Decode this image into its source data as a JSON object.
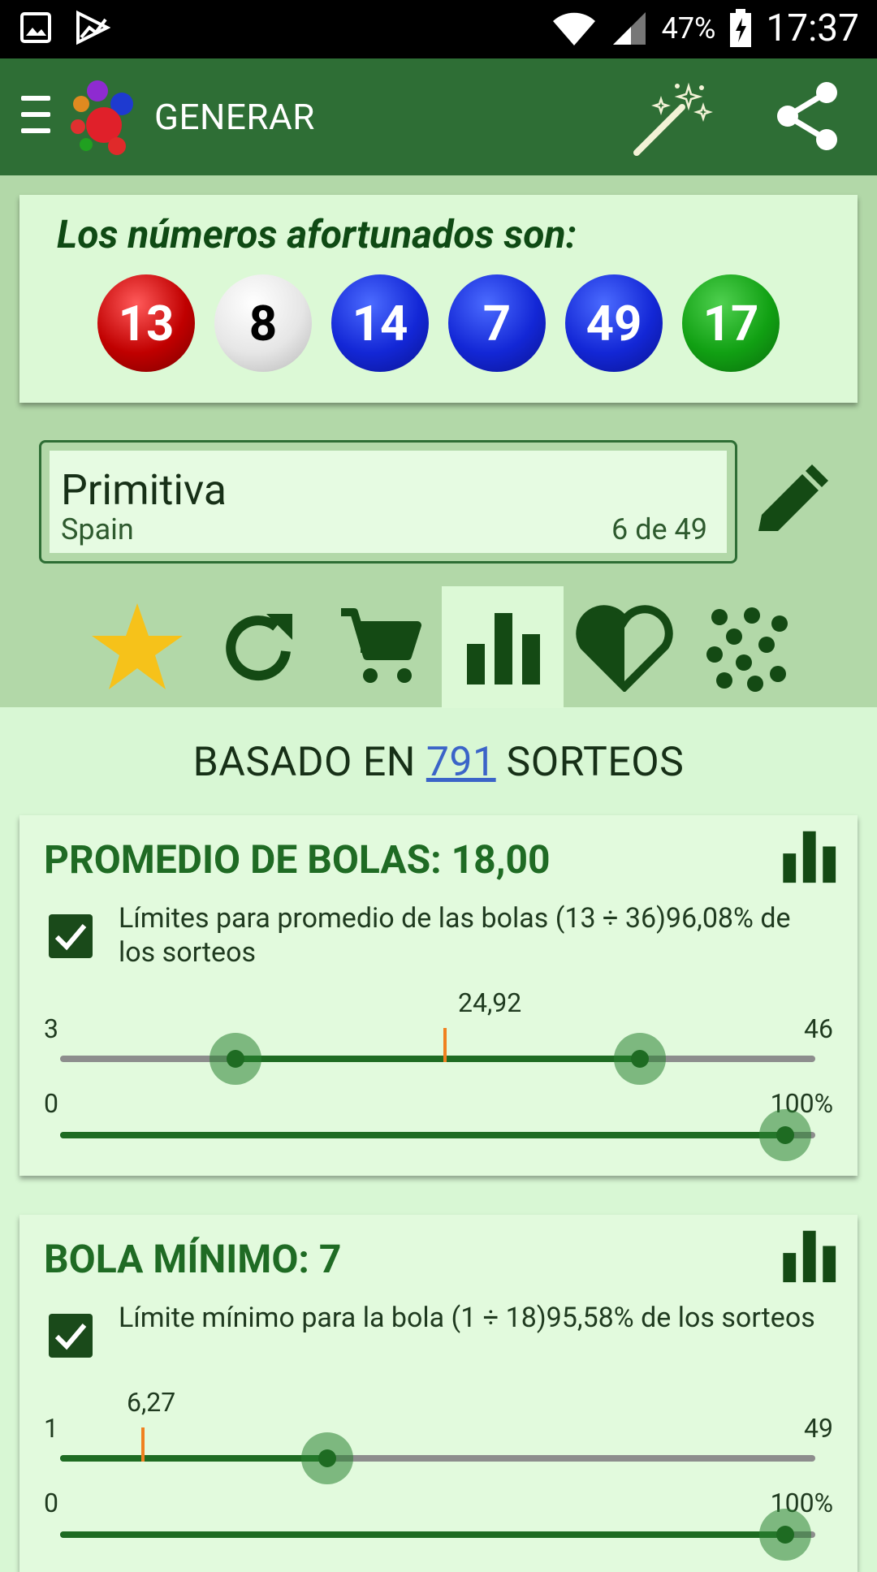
{
  "status": {
    "battery": "47%",
    "time": "17:37"
  },
  "appbar": {
    "title": "GENERAR"
  },
  "lucky": {
    "title": "Los números afortunados son:",
    "balls": [
      {
        "number": "13",
        "color": "red"
      },
      {
        "number": "8",
        "color": "white"
      },
      {
        "number": "14",
        "color": "blue"
      },
      {
        "number": "7",
        "color": "blue"
      },
      {
        "number": "49",
        "color": "blue"
      },
      {
        "number": "17",
        "color": "green"
      }
    ]
  },
  "lottery": {
    "name": "Primitiva",
    "country": "Spain",
    "format": "6 de 49"
  },
  "tabs": [
    "star-icon",
    "refresh-icon",
    "cart-icon",
    "bar-chart-icon",
    "heart-icon",
    "dots-icon"
  ],
  "basado": {
    "prefix": "BASADO EN",
    "count": "791",
    "suffix": "SORTEOS"
  },
  "filters": [
    {
      "title": "PROMEDIO DE BOLAS: 18,00",
      "description": "Límites para promedio de las bolas (13 ÷ 36)96,08% de los sorteos",
      "checked": true,
      "range_min": "3",
      "range_max": "46",
      "marker_label": "24,92",
      "marker_value": 24.92,
      "selection_low": 13,
      "selection_high": 36,
      "percent_min": "0",
      "percent_max": "100%",
      "percent_value": 0.96
    },
    {
      "title": "BOLA MÍNIMO: 7",
      "description": "Límite mínimo para la bola (1 ÷ 18)95,58% de los sorteos",
      "checked": true,
      "range_min": "1",
      "range_max": "49",
      "marker_label": "6,27",
      "marker_value": 6.27,
      "selection_low": 1,
      "selection_high": 18,
      "percent_min": "0",
      "percent_max": "100%",
      "percent_value": 0.96
    }
  ],
  "colors": {
    "appbar": "#2e6e35",
    "accent": "#1e6b22",
    "marker": "#f08020"
  }
}
